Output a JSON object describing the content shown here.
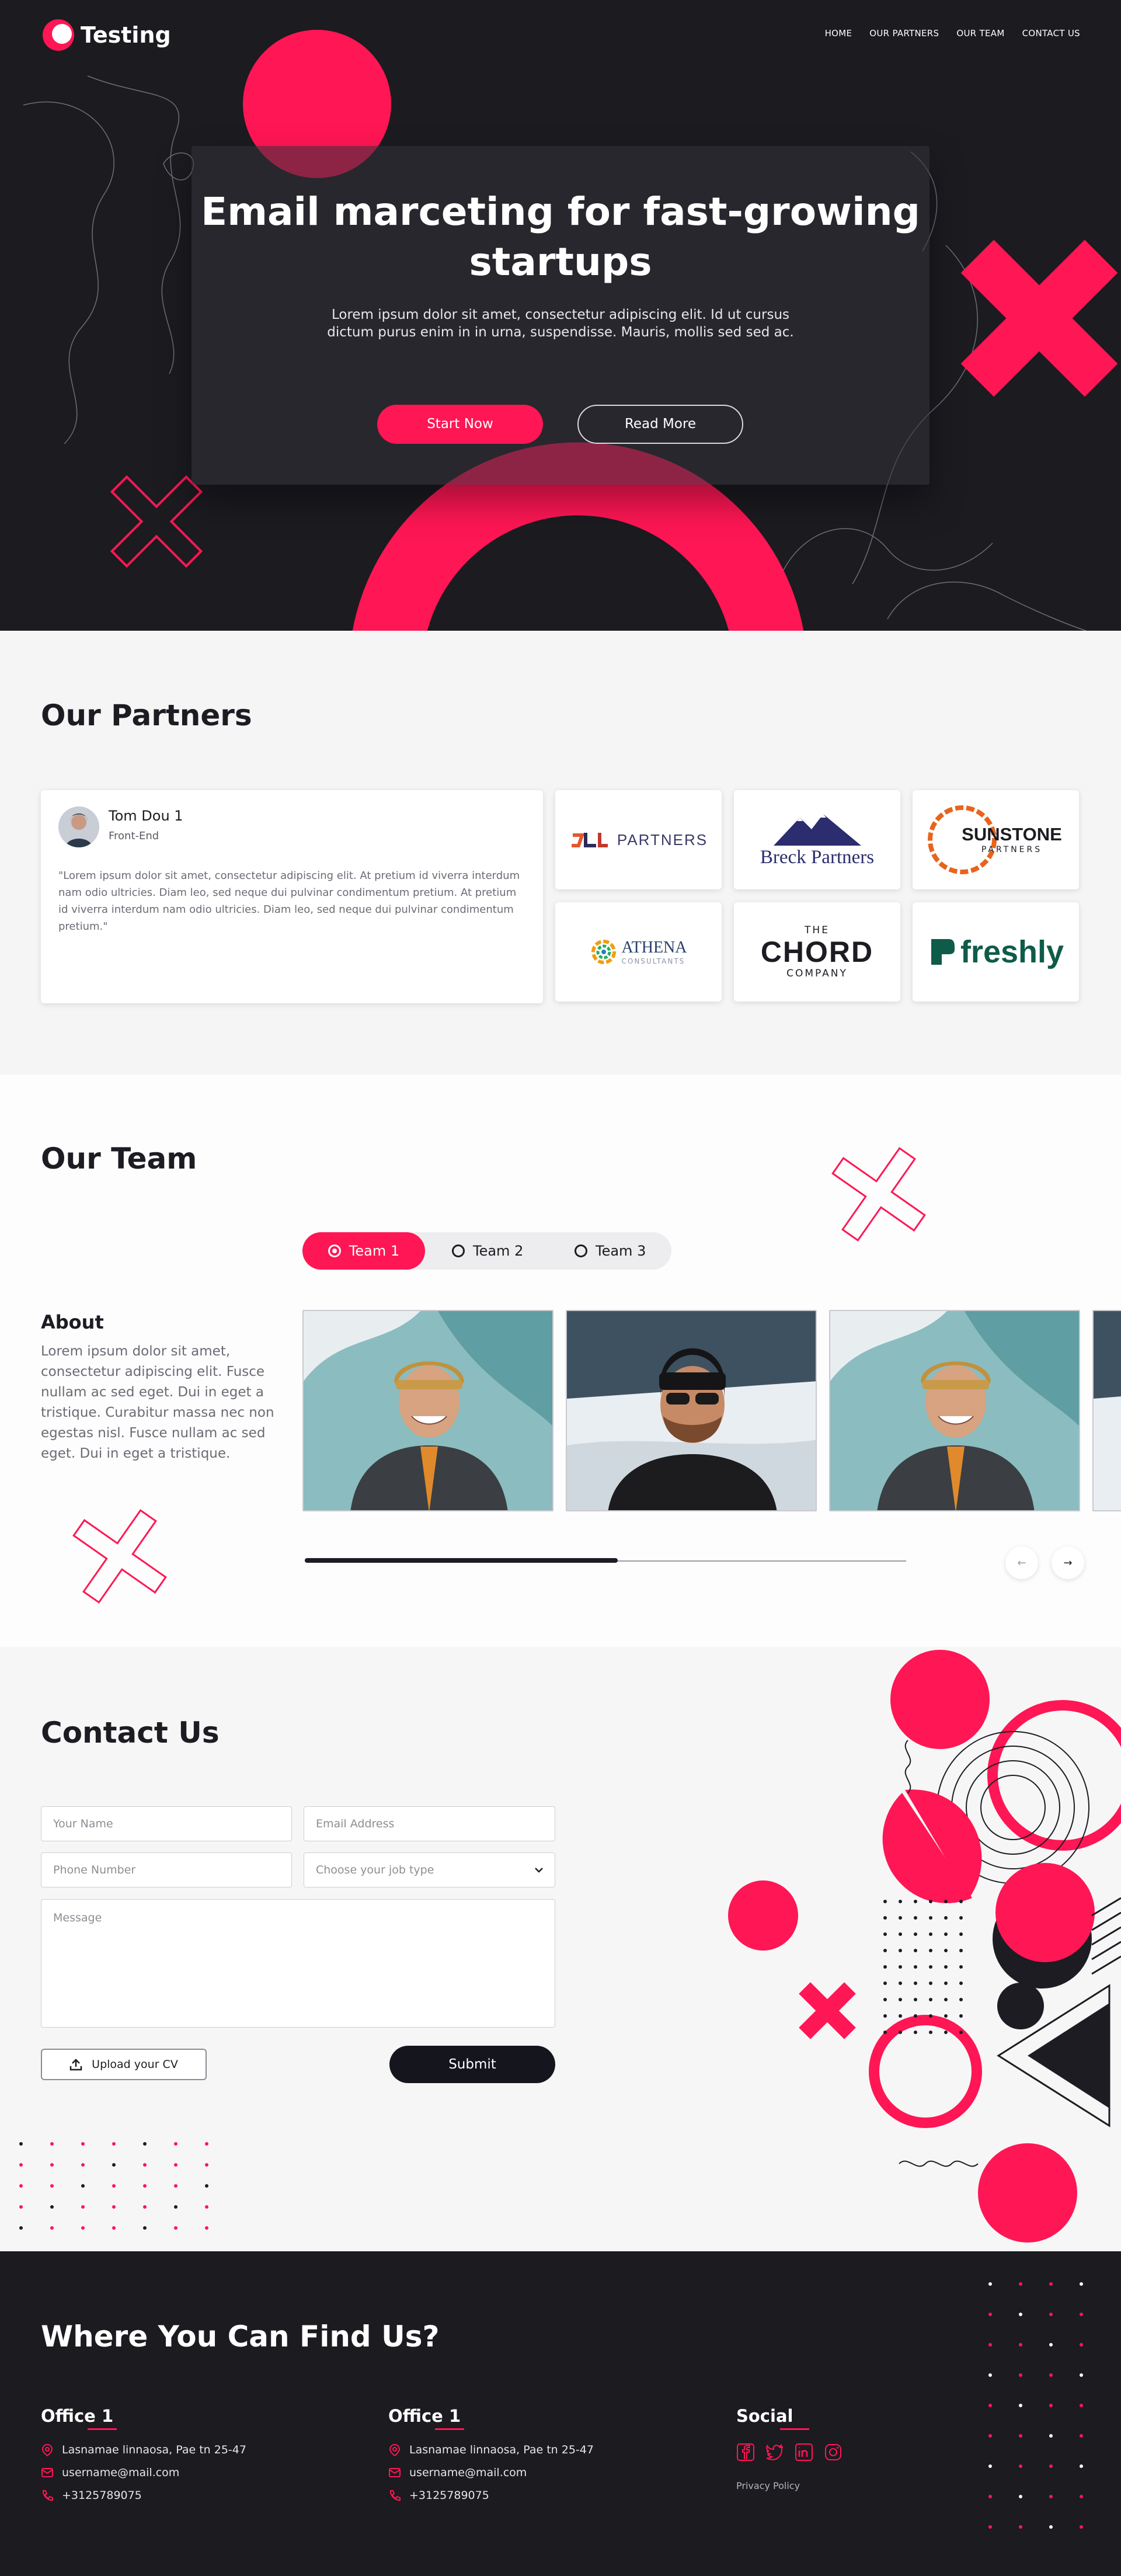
{
  "colors": {
    "accent": "#ff1654",
    "dark": "#1b1b20",
    "light": "#f6f6f7"
  },
  "header": {
    "brand": "Testing",
    "nav": [
      "HOME",
      "OUR PARTNERS",
      "OUR TEAM",
      "CONTACT US"
    ]
  },
  "hero": {
    "title": "Email marceting for fast-growing startups",
    "subtitle": "Lorem ipsum dolor sit amet, consectetur adipiscing elit. Id ut cursus dictum purus enim in in urna, suspendisse. Mauris, mollis sed sed ac.",
    "primary_button": "Start Now",
    "secondary_button": "Read More"
  },
  "partners": {
    "title": "Our Partners",
    "testimonial": {
      "name": "Tom Dou 1",
      "role": "Front-End",
      "quote": "\"Lorem ipsum dolor sit amet, consectetur adipiscing elit. At pretium id viverra interdum nam odio ultricies. Diam leo, sed neque dui pulvinar condimentum pretium. At pretium id viverra interdum nam odio ultricies. Diam leo, sed neque dui pulvinar condimentum pretium.\""
    },
    "logos": [
      {
        "name": "STL",
        "text": "PARTNERS"
      },
      {
        "name": "Breck Partners",
        "text": "Breck Partners"
      },
      {
        "name": "Sunstone Partners",
        "text": "SUNSTONE",
        "sub": "PARTNERS"
      },
      {
        "name": "Athena Consultants",
        "text": "ATHENA",
        "sub": "CONSULTANTS"
      },
      {
        "name": "The Chord Company",
        "pre": "THE",
        "text": "CHORD",
        "sub": "COMPANY"
      },
      {
        "name": "freshly",
        "text": "freshly"
      }
    ]
  },
  "team": {
    "title": "Our Team",
    "tabs": [
      "Team 1",
      "Team 2",
      "Team 3"
    ],
    "active_tab": "Team 1",
    "about_title": "About",
    "about_text": "Lorem ipsum dolor sit amet, consectetur adipiscing elit. Fusce nullam ac sed eget. Dui in eget a tristique. Curabitur massa nec non egestas nisl. Fusce nullam ac sed eget. Dui in eget a tristique.",
    "slider_progress": 0.52,
    "prev_label": "←",
    "next_label": "→"
  },
  "contact": {
    "title": "Contact Us",
    "name_placeholder": "Your Name",
    "email_placeholder": "Email Address",
    "phone_placeholder": "Phone Number",
    "job_placeholder": "Choose your job type",
    "message_placeholder": "Message",
    "upload_label": "Upload your CV",
    "submit_label": "Submit"
  },
  "footer": {
    "title": "Where You Can Find Us?",
    "offices": [
      {
        "heading": "Office 1",
        "address": "Lasnamae linnaosa, Pae tn 25-47",
        "email": "username@mail.com",
        "phone": "+3125789075"
      },
      {
        "heading": "Office 1",
        "address": "Lasnamae linnaosa, Pae tn 25-47",
        "email": "username@mail.com",
        "phone": "+3125789075"
      }
    ],
    "social_heading": "Social",
    "social_icons": [
      "facebook-icon",
      "twitter-icon",
      "linkedin-icon",
      "instagram-icon"
    ],
    "privacy": "Privacy Policy"
  }
}
